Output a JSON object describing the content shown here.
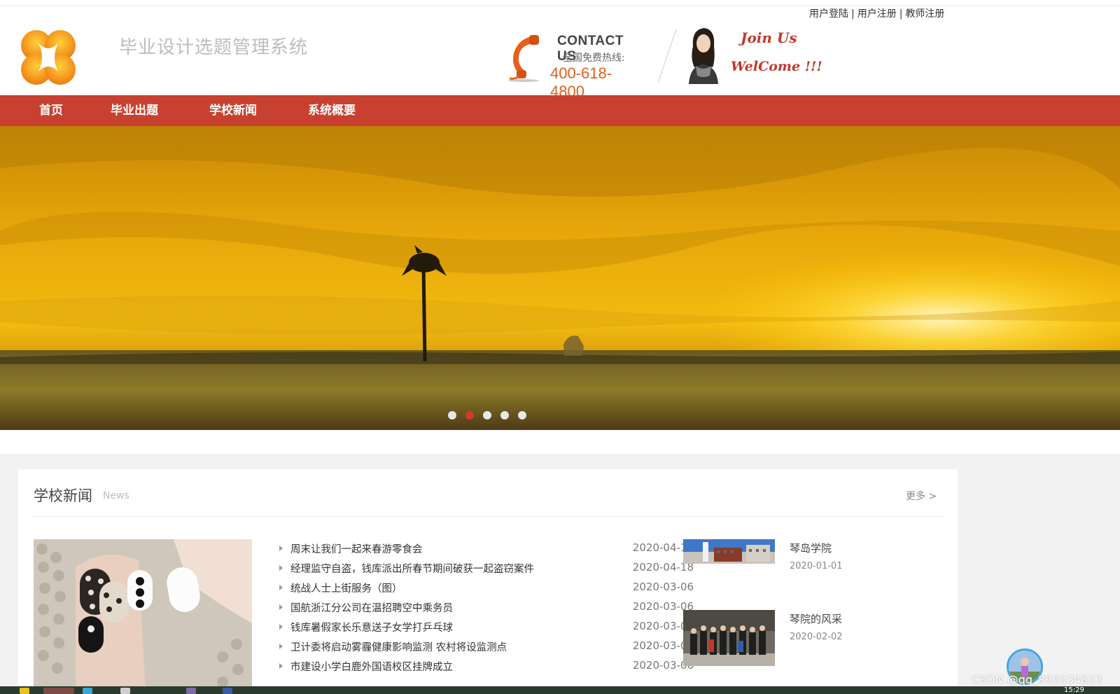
{
  "header": {
    "site_title": "毕业设计选题管理系统",
    "top_links": [
      "用户登陆",
      "用户注册",
      "教师注册"
    ],
    "top_links_sep": "|",
    "contact_us": "CONTACT US",
    "hotline_label": "全国免费热线:",
    "hotline_number": "400-618-4800",
    "join_us": "Join Us",
    "welcome": "WelCome !!!"
  },
  "nav": {
    "items": [
      "首页",
      "毕业出题",
      "学校新闻",
      "系统概要"
    ]
  },
  "banner": {
    "slide_count": 5,
    "active_slide": 2
  },
  "news": {
    "title": "学校新闻",
    "subtitle": "News",
    "more": "更多 >",
    "items": [
      {
        "title": "周末让我们一起来春游零食会",
        "date": "2020-04-18"
      },
      {
        "title": "经理监守自盗，钱库派出所春节期间破获一起盗窃案件",
        "date": "2020-04-18"
      },
      {
        "title": "统战人士上街服务（图）",
        "date": "2020-03-06"
      },
      {
        "title": "国航浙江分公司在温招聘空中乘务员",
        "date": "2020-03-06"
      },
      {
        "title": "钱库暑假家长乐意送子女学打乒乓球",
        "date": "2020-03-06"
      },
      {
        "title": "卫计委将启动雾霾健康影响监测 农村将设监测点",
        "date": "2020-03-06"
      },
      {
        "title": "市建设小学白鹿外国语校区挂牌成立",
        "date": "2020-03-06"
      }
    ],
    "pic_items": [
      {
        "title": "琴岛学院",
        "date": "2020-01-01"
      },
      {
        "title": "琴院的风采",
        "date": "2020-02-02"
      }
    ]
  },
  "footer": {
    "watermark": "CSDN @qq_892034822",
    "clock": "15:29"
  },
  "colors": {
    "nav_bg": "#c8402f",
    "accent_orange": "#e0611e",
    "join_red": "#c0392b"
  }
}
